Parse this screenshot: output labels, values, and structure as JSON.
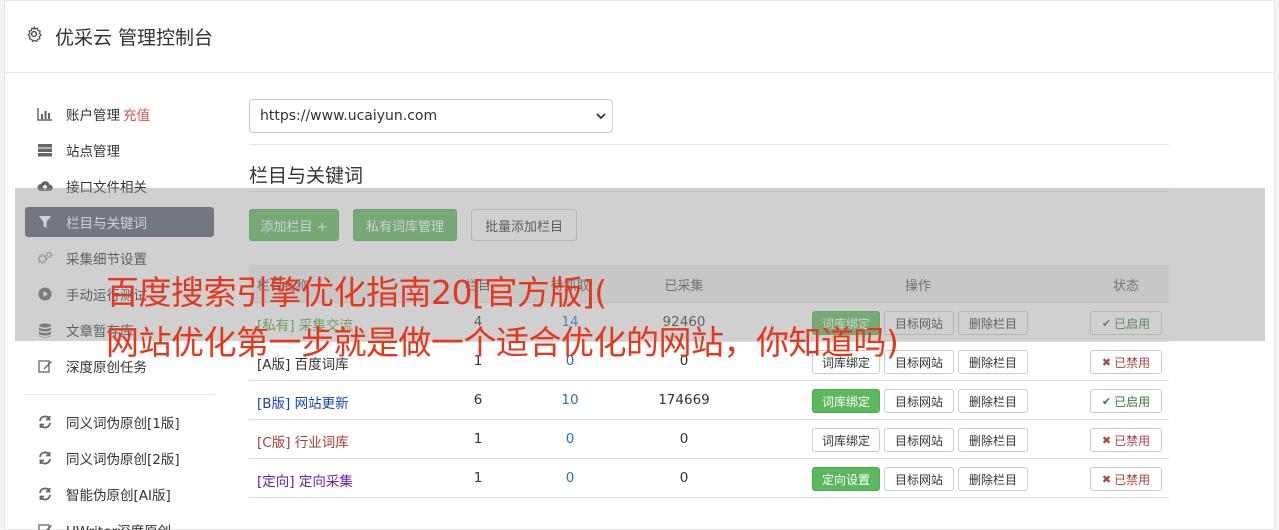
{
  "header": {
    "title": "优采云 管理控制台",
    "icon": "gear-icon"
  },
  "sidebar": {
    "items": [
      {
        "label": "账户管理",
        "extra": "充值",
        "icon": "bar-chart-icon"
      },
      {
        "label": "站点管理",
        "icon": "server-icon"
      },
      {
        "label": "接口文件相关",
        "icon": "cloud-upload-icon"
      },
      {
        "label": "栏目与关键词",
        "icon": "filter-icon",
        "active": true
      },
      {
        "label": "采集细节设置",
        "icon": "cogs-icon"
      },
      {
        "label": "手动运行测试",
        "icon": "play-icon"
      },
      {
        "label": "文章暂存库",
        "icon": "database-icon"
      },
      {
        "label": "深度原创任务",
        "icon": "edit-icon"
      },
      {
        "label": "同义词伪原创[1版]",
        "icon": "refresh-icon"
      },
      {
        "label": "同义词伪原创[2版]",
        "icon": "refresh-icon"
      },
      {
        "label": "智能伪原创[AI版]",
        "icon": "refresh-icon"
      },
      {
        "label": "UWriter深度原创",
        "icon": "edit-icon"
      }
    ]
  },
  "main": {
    "site_select": "https://www.ucaiyun.com",
    "section_title": "栏目与关键词",
    "toolbar": {
      "add_column": "添加栏目 +",
      "private_lib": "私有词库管理",
      "batch_add": "批量添加栏目"
    },
    "table": {
      "headers": [
        "栏目名称",
        "栏目",
        "待抓取",
        "已采集",
        "操作",
        "状态"
      ],
      "rows": [
        {
          "tag": "[私有]",
          "name": "采集交流",
          "c1": "4",
          "c2": "14",
          "c3": "92460",
          "op1": "词库绑定",
          "op2": "目标网站",
          "op3": "删除栏目",
          "status": "已启用",
          "tag_color": "#5b9a3c"
        },
        {
          "tag": "[A版]",
          "name": "百度词库",
          "c1": "1",
          "c2": "0",
          "c3": "0",
          "op1": "词库绑定",
          "op2": "目标网站",
          "op3": "删除栏目",
          "status": "已禁用",
          "tag_color": "#333333"
        },
        {
          "tag": "[B版]",
          "name": "网站更新",
          "c1": "6",
          "c2": "10",
          "c3": "174669",
          "op1": "词库绑定",
          "op2": "目标网站",
          "op3": "删除栏目",
          "status": "已启用",
          "tag_color": "#1a3fc4"
        },
        {
          "tag": "[C版]",
          "name": "行业词库",
          "c1": "1",
          "c2": "0",
          "c3": "0",
          "op1": "词库绑定",
          "op2": "目标网站",
          "op3": "删除栏目",
          "status": "已禁用",
          "tag_color": "#b03a2e"
        },
        {
          "tag": "[定向]",
          "name": "定向采集",
          "c1": "1",
          "c2": "0",
          "c3": "0",
          "op1": "定向设置",
          "op2": "目标网站",
          "op3": "删除栏目",
          "status": "已禁用",
          "tag_color": "#6a1fb0"
        }
      ]
    }
  },
  "overlay": {
    "line1": "百度搜索引擎优化指南20[官方版](",
    "line2": "网站优化第一步就是做一个适合优化的网站，你知道吗)"
  },
  "colors": {
    "accent_green": "#5cb85c",
    "sidebar_active": "#56606d",
    "overlay_text": "#e8361c"
  }
}
